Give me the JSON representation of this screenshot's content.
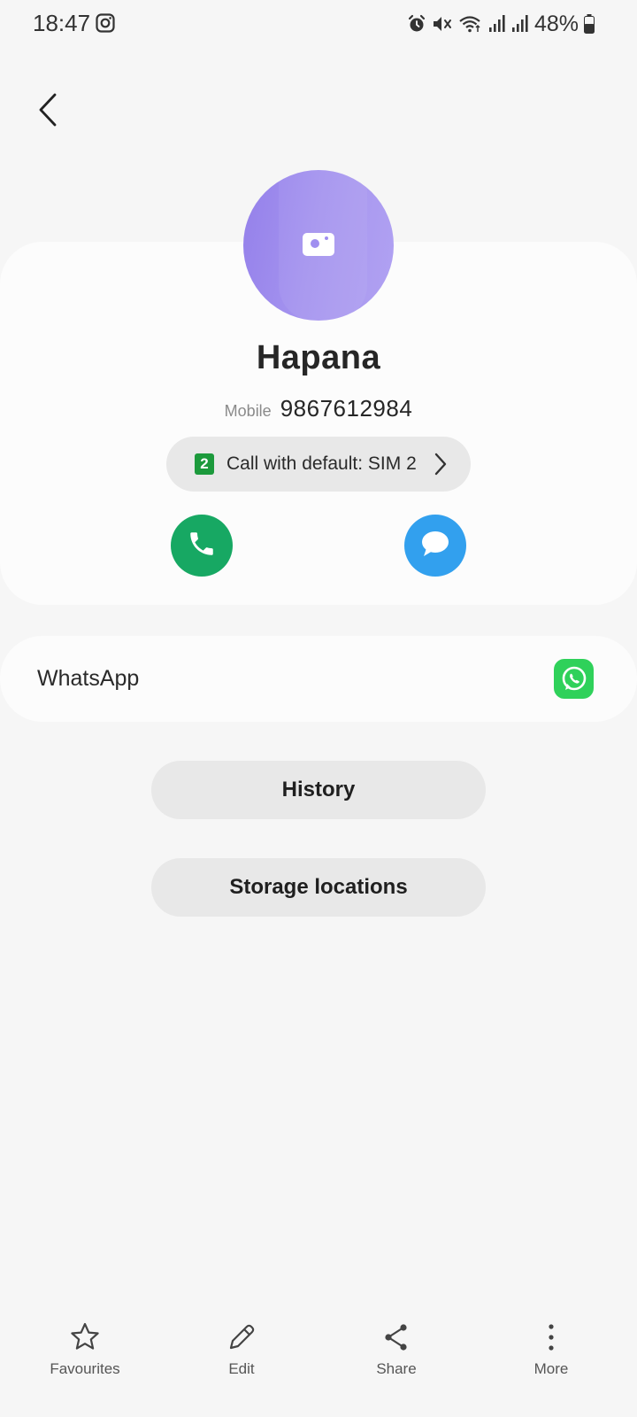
{
  "status_bar": {
    "time": "18:47",
    "battery_percent": "48%",
    "icons": [
      "instagram-icon",
      "alarm-icon",
      "mute-icon",
      "wifi-icon",
      "signal-icon",
      "signal-icon",
      "battery-icon"
    ]
  },
  "header": {
    "back_icon": "chevron-left-icon"
  },
  "contact": {
    "name": "Hapana",
    "number_label": "Mobile",
    "number": "9867612984",
    "sim_badge": "2",
    "call_default_label": "Call with default: SIM 2",
    "avatar_icon": "camera-icon",
    "avatar_color": "#9e8cee"
  },
  "actions": {
    "call_icon": "phone-icon",
    "call_color": "#17a863",
    "message_icon": "message-icon",
    "message_color": "#32a0ee"
  },
  "linked_apps": {
    "whatsapp_label": "WhatsApp",
    "whatsapp_icon": "whatsapp-icon",
    "whatsapp_color": "#2fd15a"
  },
  "buttons": {
    "history": "History",
    "storage": "Storage locations"
  },
  "bottom_nav": [
    {
      "label": "Favourites",
      "icon": "star-icon"
    },
    {
      "label": "Edit",
      "icon": "pencil-icon"
    },
    {
      "label": "Share",
      "icon": "share-icon"
    },
    {
      "label": "More",
      "icon": "more-vertical-icon"
    }
  ]
}
